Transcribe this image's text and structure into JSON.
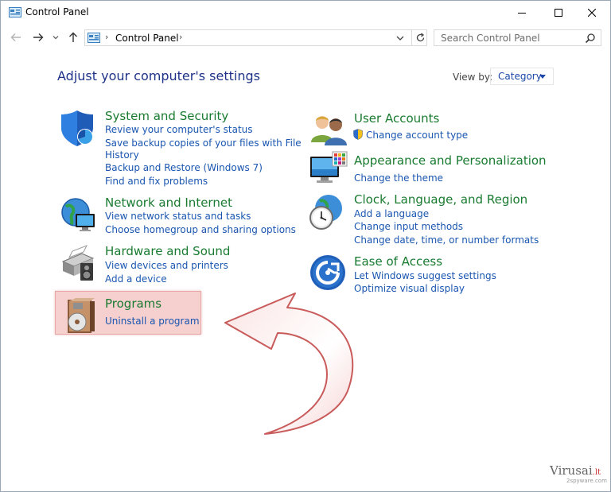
{
  "window": {
    "title": "Control Panel"
  },
  "address": {
    "crumb": "Control Panel",
    "search_placeholder": "Search Control Panel"
  },
  "header": {
    "title": "Adjust your computer's settings",
    "view_by_label": "View by:",
    "view_by_value": "Category"
  },
  "categories": {
    "system": {
      "title": "System and Security",
      "links": [
        "Review your computer's status",
        "Save backup copies of your files with File",
        "History",
        "Backup and Restore (Windows 7)",
        "Find and fix problems"
      ]
    },
    "network": {
      "title": "Network and Internet",
      "links": [
        "View network status and tasks",
        "Choose homegroup and sharing options"
      ]
    },
    "hardware": {
      "title": "Hardware and Sound",
      "links": [
        "View devices and printers",
        "Add a device"
      ]
    },
    "programs": {
      "title": "Programs",
      "links": [
        "Uninstall a program"
      ]
    },
    "users": {
      "title": "User Accounts",
      "links": [
        "Change account type"
      ]
    },
    "appearance": {
      "title": "Appearance and Personalization",
      "links": [
        "Change the theme"
      ]
    },
    "clock": {
      "title": "Clock, Language, and Region",
      "links": [
        "Add a language",
        "Change input methods",
        "Change date, time, or number formats"
      ]
    },
    "ease": {
      "title": "Ease of Access",
      "links": [
        "Let Windows suggest settings",
        "Optimize visual display"
      ]
    }
  },
  "watermark": {
    "brand": "Virusai",
    "suffix": ".lt",
    "sub": "2spyware.com"
  },
  "colors": {
    "heading": "#1e3287",
    "category_title": "#197b30",
    "link": "#1a56b0",
    "highlight": "#f6cfcf"
  }
}
